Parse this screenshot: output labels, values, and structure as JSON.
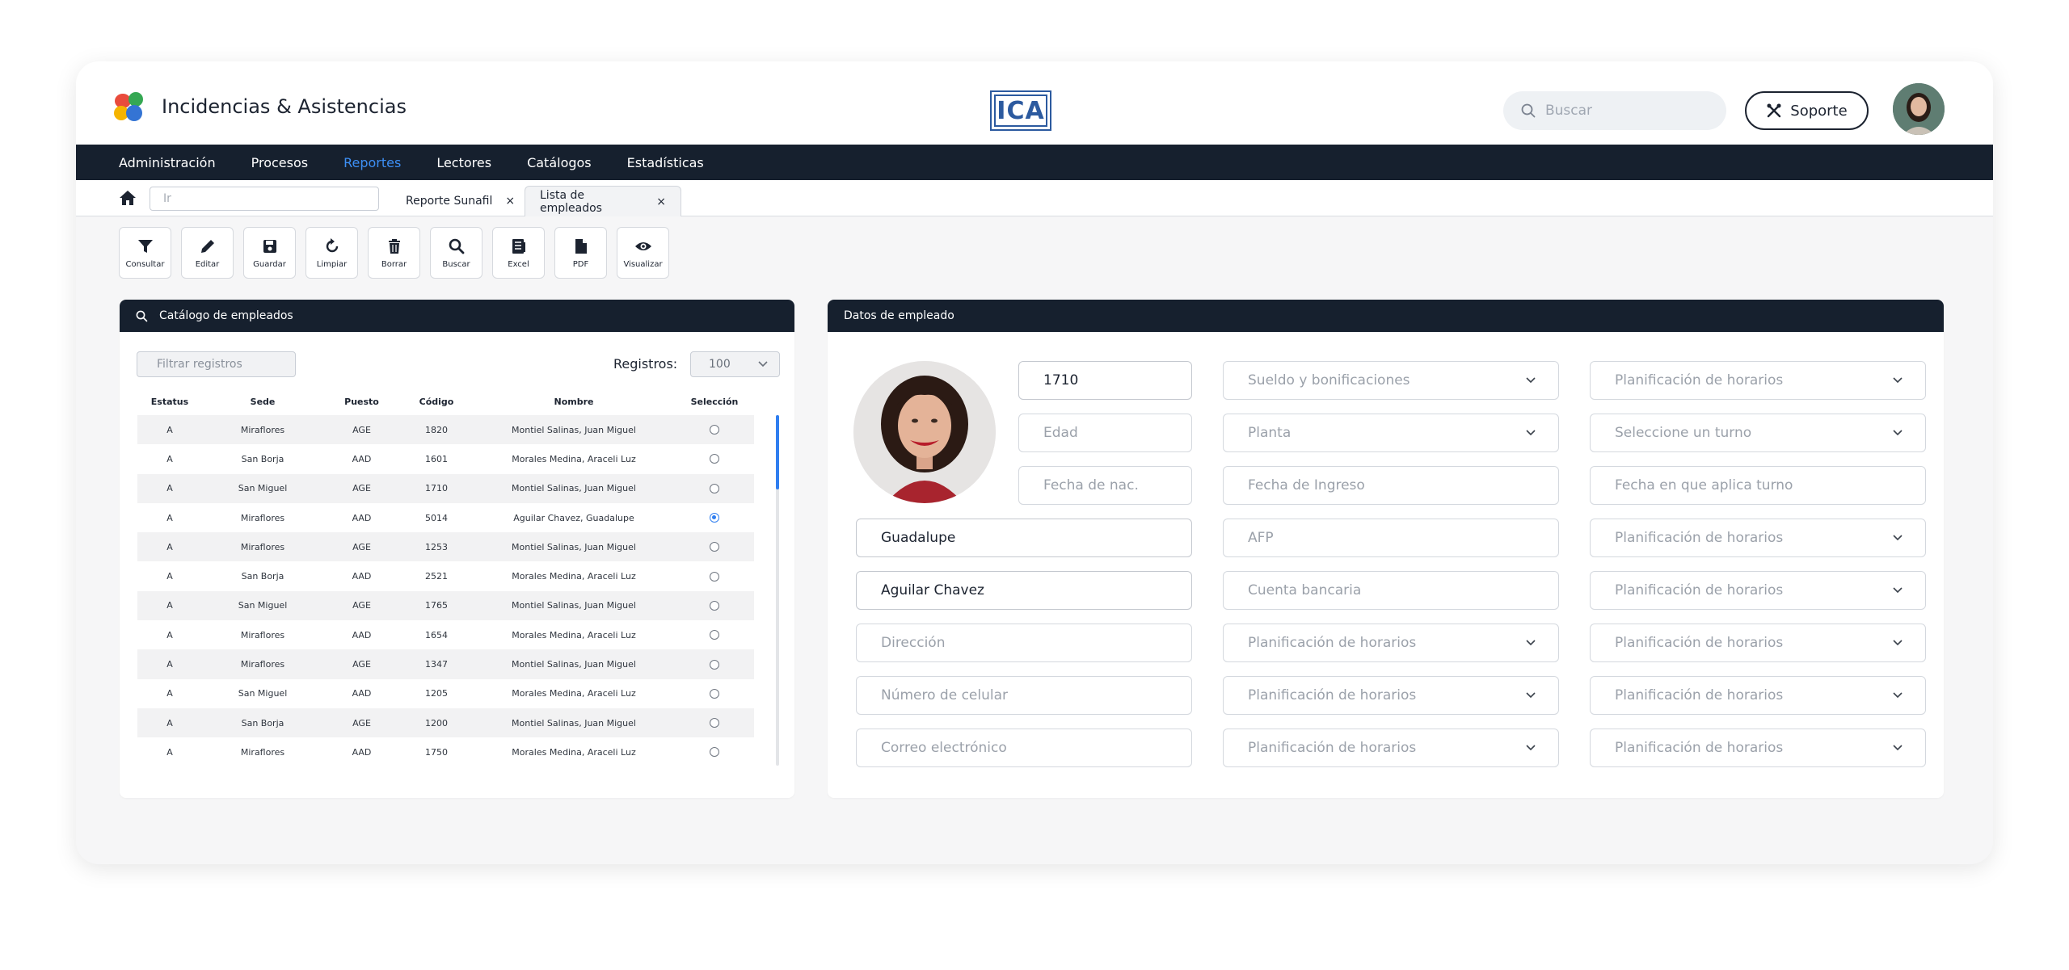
{
  "header": {
    "app_title": "Incidencias & Asistencias",
    "brand_text": "ICA",
    "search_placeholder": "Buscar",
    "support_label": "Soporte"
  },
  "nav": {
    "items": [
      "Administración",
      "Procesos",
      "Reportes",
      "Lectores",
      "Catálogos",
      "Estadísticas"
    ],
    "active": "Reportes"
  },
  "tabbar": {
    "goto_placeholder": "Ir",
    "tabs": [
      {
        "label": "Reporte Sunafil",
        "close": "×"
      },
      {
        "label": "Lista de empleados",
        "close": "×"
      }
    ]
  },
  "toolbar": {
    "buttons": [
      "Consultar",
      "Editar",
      "Guardar",
      "Limpiar",
      "Borrar",
      "Buscar",
      "Excel",
      "PDF",
      "Visualizar"
    ]
  },
  "catalog": {
    "title": "Catálogo de empleados",
    "filter_placeholder": "Filtrar registros",
    "registros_label": "Registros:",
    "registros_value": "100",
    "columns": [
      "Estatus",
      "Sede",
      "Puesto",
      "Código",
      "Nombre",
      "Selección"
    ],
    "rows": [
      {
        "estatus": "A",
        "sede": "Miraflores",
        "puesto": "AGE",
        "codigo": "1820",
        "nombre": "Montiel Salinas, Juan Miguel",
        "selected": false
      },
      {
        "estatus": "A",
        "sede": "San Borja",
        "puesto": "AAD",
        "codigo": "1601",
        "nombre": "Morales Medina, Araceli Luz",
        "selected": false
      },
      {
        "estatus": "A",
        "sede": "San Miguel",
        "puesto": "AGE",
        "codigo": "1710",
        "nombre": "Montiel Salinas, Juan Miguel",
        "selected": false
      },
      {
        "estatus": "A",
        "sede": "Miraflores",
        "puesto": "AAD",
        "codigo": "5014",
        "nombre": "Aguilar Chavez, Guadalupe",
        "selected": true
      },
      {
        "estatus": "A",
        "sede": "Miraflores",
        "puesto": "AGE",
        "codigo": "1253",
        "nombre": "Montiel Salinas, Juan Miguel",
        "selected": false
      },
      {
        "estatus": "A",
        "sede": "San Borja",
        "puesto": "AAD",
        "codigo": "2521",
        "nombre": "Morales Medina, Araceli Luz",
        "selected": false
      },
      {
        "estatus": "A",
        "sede": "San Miguel",
        "puesto": "AGE",
        "codigo": "1765",
        "nombre": "Montiel Salinas, Juan Miguel",
        "selected": false
      },
      {
        "estatus": "A",
        "sede": "Miraflores",
        "puesto": "AAD",
        "codigo": "1654",
        "nombre": "Morales Medina, Araceli Luz",
        "selected": false
      },
      {
        "estatus": "A",
        "sede": "Miraflores",
        "puesto": "AGE",
        "codigo": "1347",
        "nombre": "Montiel Salinas, Juan Miguel",
        "selected": false
      },
      {
        "estatus": "A",
        "sede": "San Miguel",
        "puesto": "AAD",
        "codigo": "1205",
        "nombre": "Morales Medina, Araceli Luz",
        "selected": false
      },
      {
        "estatus": "A",
        "sede": "San Borja",
        "puesto": "AGE",
        "codigo": "1200",
        "nombre": "Montiel Salinas, Juan Miguel",
        "selected": false
      },
      {
        "estatus": "A",
        "sede": "Miraflores",
        "puesto": "AAD",
        "codigo": "1750",
        "nombre": "Morales Medina, Araceli Luz",
        "selected": false
      }
    ]
  },
  "employee": {
    "title": "Datos de empleado",
    "codigo": "1710",
    "edad_placeholder": "Edad",
    "fecha_nac_placeholder": "Fecha de nac.",
    "nombre": "Guadalupe",
    "apellidos": "Aguilar Chavez",
    "direccion_placeholder": "Dirección",
    "celular_placeholder": "Número de celular",
    "correo_placeholder": "Correo electrónico",
    "col2": [
      "Sueldo y bonificaciones",
      "Planta",
      "Fecha de Ingreso",
      "AFP",
      "Cuenta bancaria",
      "Planificación de horarios",
      "Planificación de horarios",
      "Planificación de horarios"
    ],
    "col3": [
      "Planificación de horarios",
      "Seleccione un turno",
      "Fecha en que aplica turno",
      "Planificación de horarios",
      "Planificación de horarios",
      "Planificación de horarios",
      "Planificación de horarios",
      "Planificación de horarios"
    ]
  }
}
